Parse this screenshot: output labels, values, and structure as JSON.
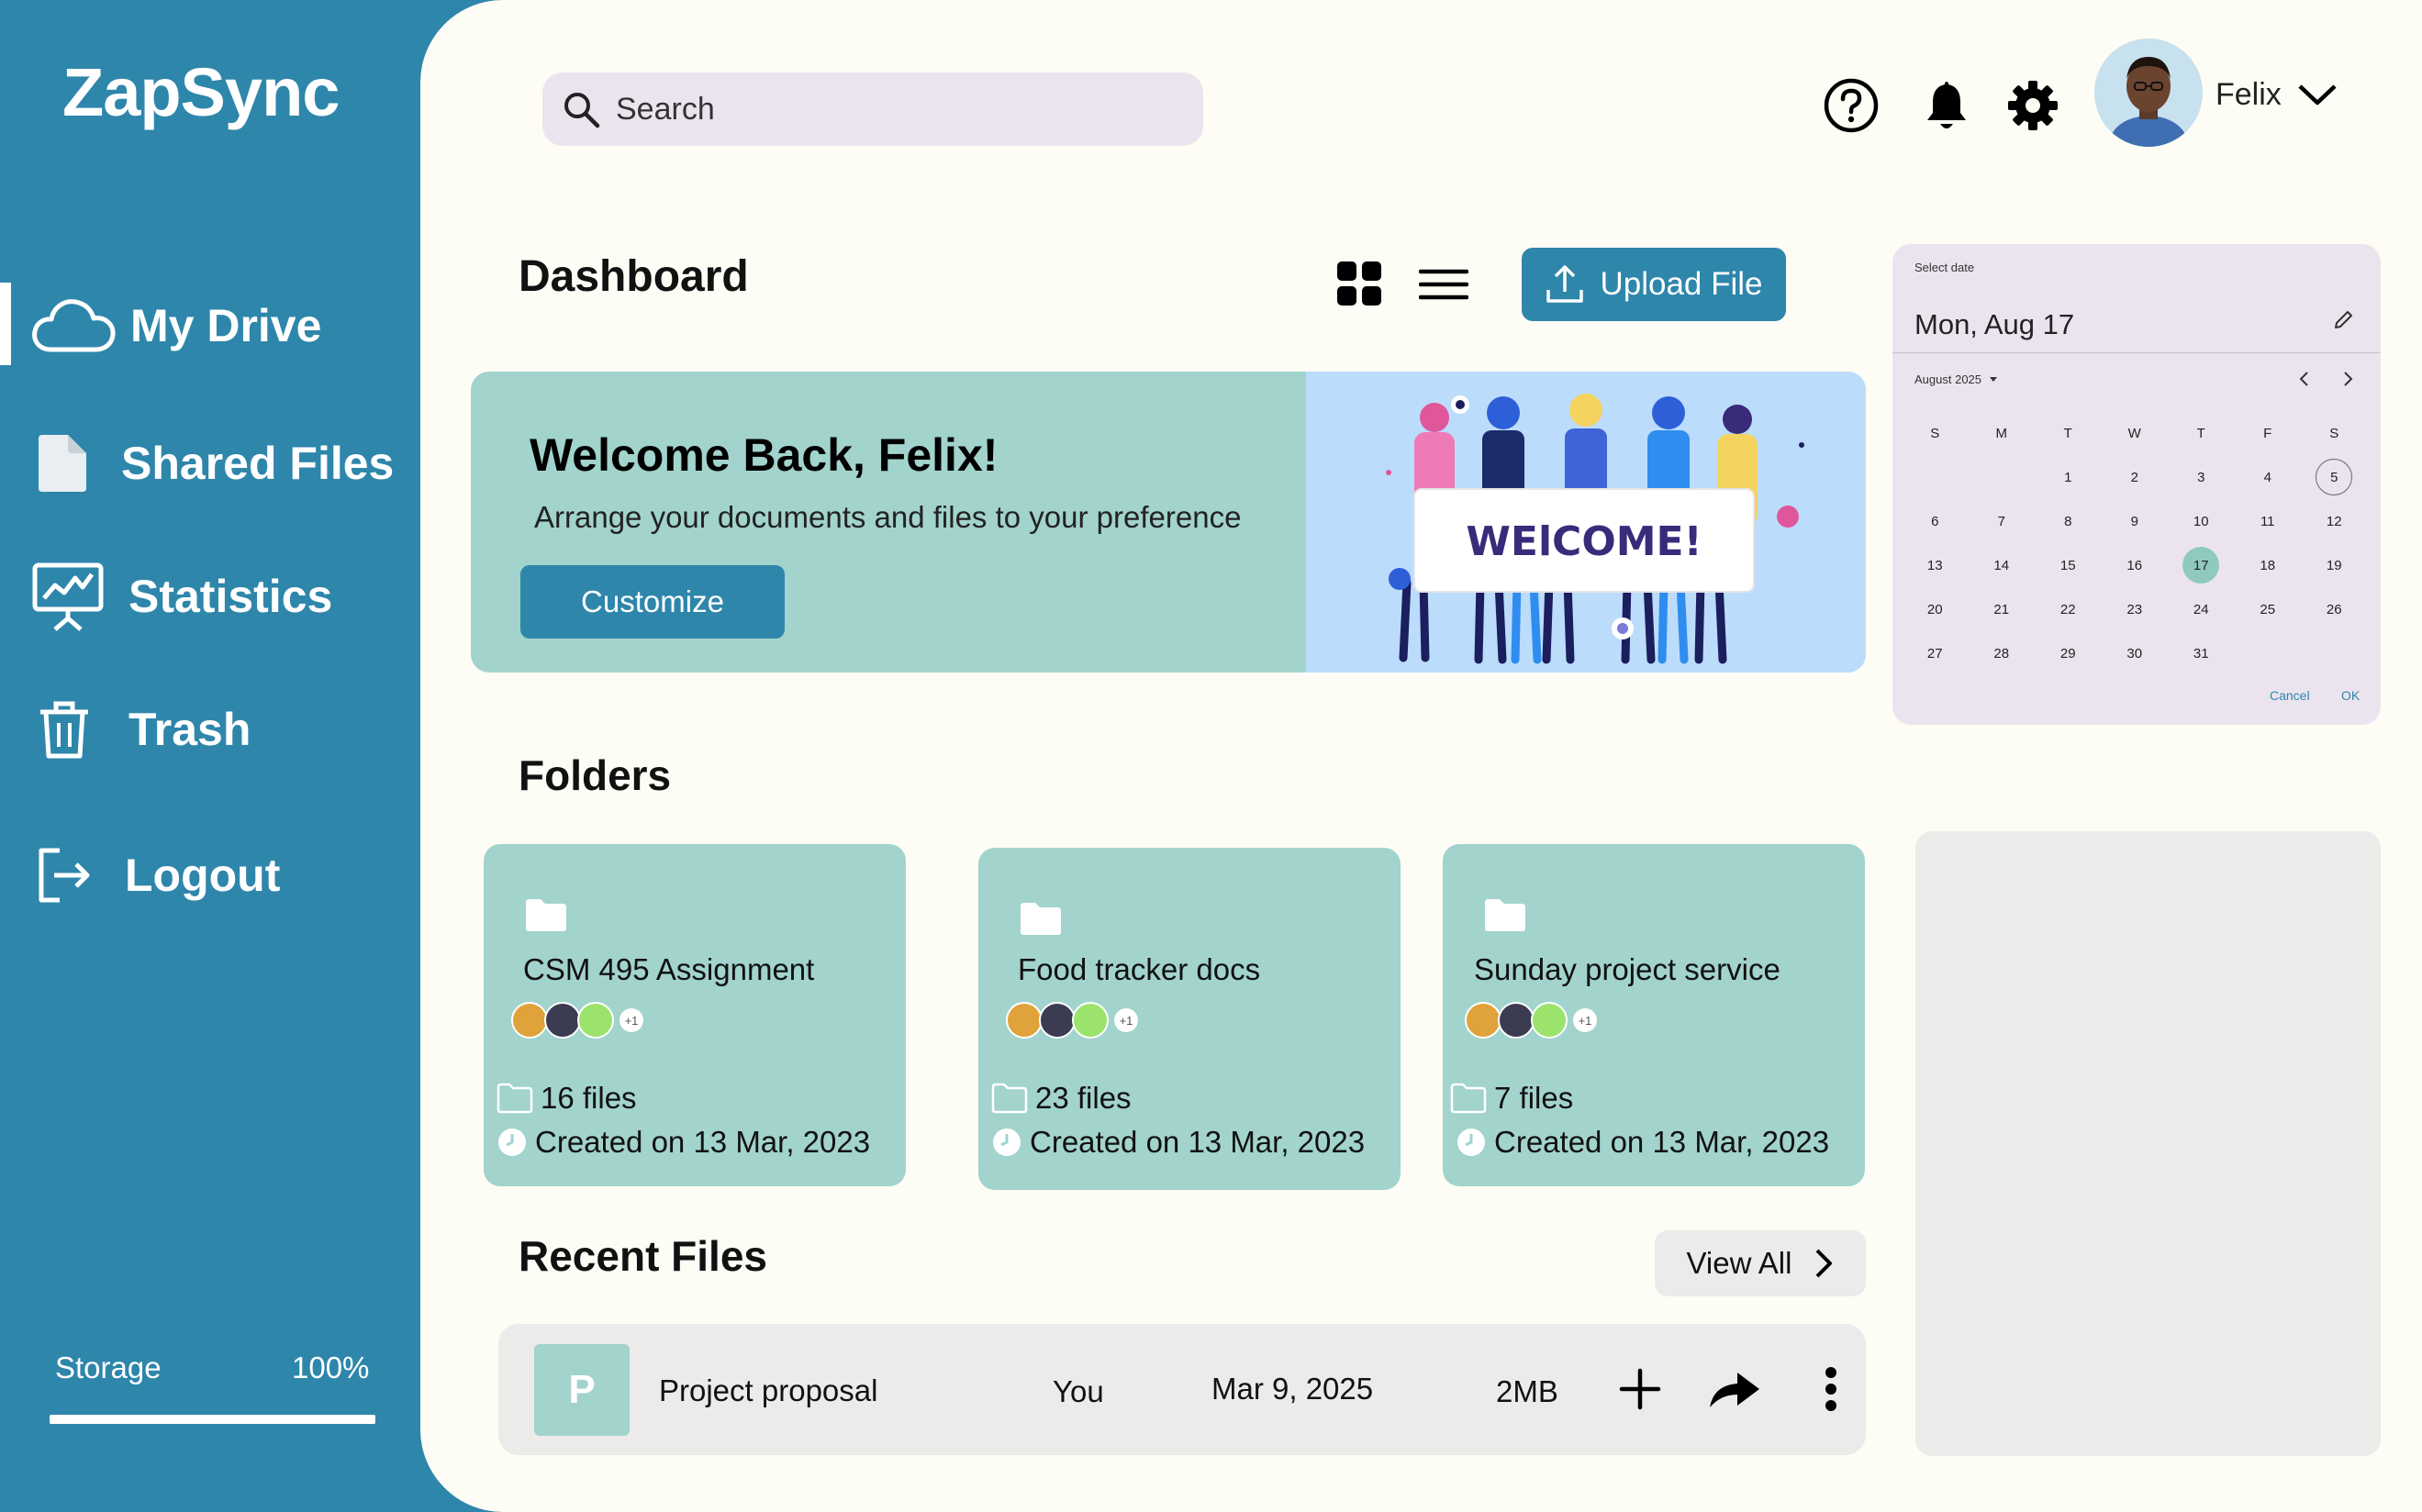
{
  "app": {
    "name": "ZapSync"
  },
  "sidebar": {
    "items": [
      {
        "label": "My Drive",
        "icon": "cloud-icon",
        "active": true
      },
      {
        "label": "Shared Files",
        "icon": "file-icon"
      },
      {
        "label": "Statistics",
        "icon": "presentation-chart-icon"
      },
      {
        "label": "Trash",
        "icon": "trash-icon"
      },
      {
        "label": "Logout",
        "icon": "logout-icon"
      }
    ],
    "storage": {
      "label": "Storage",
      "value": "100%",
      "fraction": 1.0
    }
  },
  "header": {
    "search_placeholder": "Search",
    "user_name": "Felix"
  },
  "dashboard": {
    "title": "Dashboard",
    "upload_label": "Upload File"
  },
  "welcome": {
    "title": "Welcome Back, Felix!",
    "subtitle": "Arrange your documents and files to your preference",
    "button": "Customize",
    "banner_text": "WElCOME!"
  },
  "folders": {
    "title": "Folders",
    "items": [
      {
        "name": "CSM 495 Assignment",
        "extra_members": "+1",
        "files": "16 files",
        "created": "Created on 13 Mar, 2023"
      },
      {
        "name": "Food tracker docs",
        "extra_members": "+1",
        "files": "23 files",
        "created": "Created on 13 Mar, 2023"
      },
      {
        "name": "Sunday project service",
        "extra_members": "+1",
        "files": "7 files",
        "created": "Created on 13 Mar, 2023"
      }
    ]
  },
  "recent": {
    "title": "Recent Files",
    "view_all": "View All",
    "files": [
      {
        "thumb": "P",
        "name": "Project proposal",
        "owner": "You",
        "date": "Mar 9, 2025",
        "size": "2MB"
      }
    ]
  },
  "calendar": {
    "select_label": "Select date",
    "selected_display": "Mon, Aug 17",
    "month_label": "August 2025",
    "weekdays": [
      "S",
      "M",
      "T",
      "W",
      "T",
      "F",
      "S"
    ],
    "leading_blanks": 2,
    "days": [
      "1",
      "2",
      "3",
      "4",
      "5",
      "6",
      "7",
      "8",
      "9",
      "10",
      "11",
      "12",
      "13",
      "14",
      "15",
      "16",
      "17",
      "18",
      "19",
      "20",
      "21",
      "22",
      "23",
      "24",
      "25",
      "26",
      "27",
      "28",
      "29",
      "30",
      "31"
    ],
    "today": "5",
    "selected": "17",
    "cancel": "Cancel",
    "ok": "OK"
  },
  "colors": {
    "primary": "#2e86ab",
    "teal_card": "#a2d3cd",
    "background": "#fdfdf5",
    "calendar_bg": "#ebe4ef"
  }
}
